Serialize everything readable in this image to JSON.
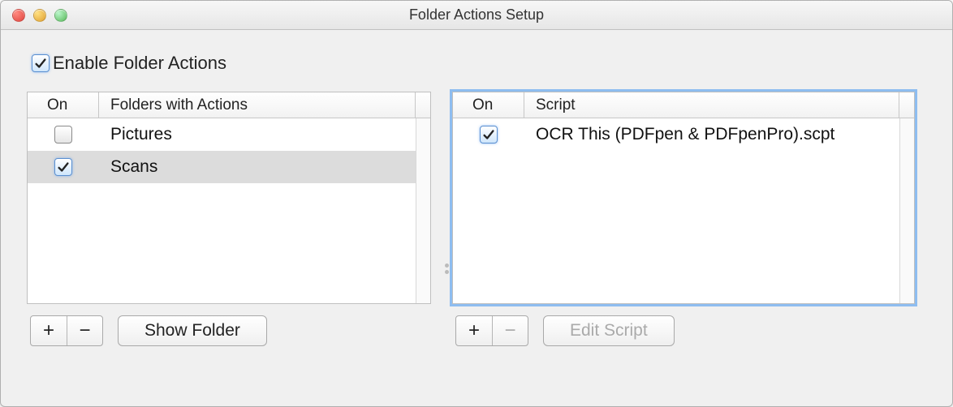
{
  "window": {
    "title": "Folder Actions Setup"
  },
  "enable": {
    "label": "Enable Folder Actions",
    "checked": true
  },
  "folders": {
    "header_on": "On",
    "header_main": "Folders with Actions",
    "items": [
      {
        "name": "Pictures",
        "checked": false,
        "selected": false
      },
      {
        "name": "Scans",
        "checked": true,
        "selected": true
      }
    ],
    "add_label": "+",
    "remove_label": "−",
    "show_button": "Show Folder"
  },
  "scripts": {
    "header_on": "On",
    "header_main": "Script",
    "items": [
      {
        "name": "OCR This (PDFpen & PDFpenPro).scpt",
        "checked": true,
        "selected": false
      }
    ],
    "add_label": "+",
    "remove_label": "−",
    "remove_enabled": false,
    "edit_button": "Edit Script",
    "edit_enabled": false
  }
}
